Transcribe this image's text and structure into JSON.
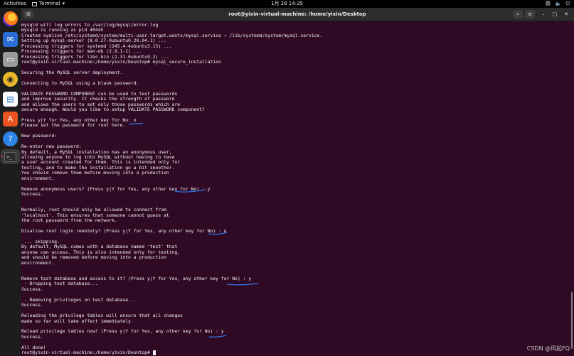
{
  "topbar": {
    "activities": "Activities",
    "app_name": "Terminal",
    "clock": "1月 28  14:35",
    "tray_icons": [
      "network-icon",
      "volume-icon",
      "power-icon"
    ]
  },
  "dock": {
    "apps": [
      "firefox-icon",
      "mail-icon",
      "files-icon",
      "rhythmbox-icon",
      "writer-icon",
      "software-icon",
      "help-icon",
      "terminal-icon"
    ],
    "active_app": "terminal-icon"
  },
  "terminal": {
    "title": "root@yixin-virtual-machine: /home/yixin/Desktop",
    "lines": [
      "mysqld will log errors to /var/log/mysql/error.log",
      "mysqld is running as pid 40445",
      "Created symlink /etc/systemd/system/multi-user.target.wants/mysql.service → /lib/systemd/system/mysql.service.",
      "Setting up mysql-server (8.0.27-0ubuntu0.20.04.1) ...",
      "Processing triggers for systemd (245.4-4ubuntu3.15) ...",
      "Processing triggers for man-db (2.9.1-1) ...",
      "Processing triggers for libc-bin (2.31-0ubuntu9.2) ...",
      "root@yixin-virtual-machine:/home/yixin/Desktop# mysql_secure_installation",
      "",
      "Securing the MySQL server deployment.",
      "",
      "Connecting to MySQL using a blank password.",
      "",
      "VALIDATE PASSWORD COMPONENT can be used to test passwords",
      "and improve security. It checks the strength of password",
      "and allows the users to set only those passwords which are",
      "secure enough. Would you like to setup VALIDATE PASSWORD component?",
      "",
      "Press y|Y for Yes, any other key for No: n",
      "Please set the password for root here.",
      "",
      "New password:",
      "",
      "Re-enter new password:",
      "By default, a MySQL installation has an anonymous user,",
      "allowing anyone to log into MySQL without having to have",
      "a user account created for them. This is intended only for",
      "testing, and to make the installation go a bit smoother.",
      "You should remove them before moving into a production",
      "environment.",
      "",
      "Remove anonymous users? (Press y|Y for Yes, any other key for No) : y",
      "Success.",
      "",
      "",
      "Normally, root should only be allowed to connect from",
      "'localhost'. This ensures that someone cannot guess at",
      "the root password from the network.",
      "",
      "Disallow root login remotely? (Press y|Y for Yes, any other key for No) : n",
      "",
      " ... skipping.",
      "By default, MySQL comes with a database named 'test' that",
      "anyone can access. This is also intended only for testing,",
      "and should be removed before moving into a production",
      "environment.",
      "",
      "",
      "Remove test database and access to it? (Press y|Y for Yes, any other key for No) : y",
      " - Dropping test database...",
      "Success.",
      "",
      " - Removing privileges on test database...",
      "Success.",
      "",
      "Reloading the privilege tables will ensure that all changes",
      "made so far will take effect immediately.",
      "",
      "Reload privilege tables now? (Press y|Y for Yes, any other key for No) : y",
      "Success.",
      "",
      "All done!"
    ],
    "prompt": "root@yixin-virtual-machine:/home/yixin/Desktop# "
  },
  "watermark": "CSDN @风起FQ",
  "colors": {
    "terminal_bg": "#300a24",
    "annotation": "#2f6fe0",
    "ubuntu_orange": "#e95420"
  }
}
